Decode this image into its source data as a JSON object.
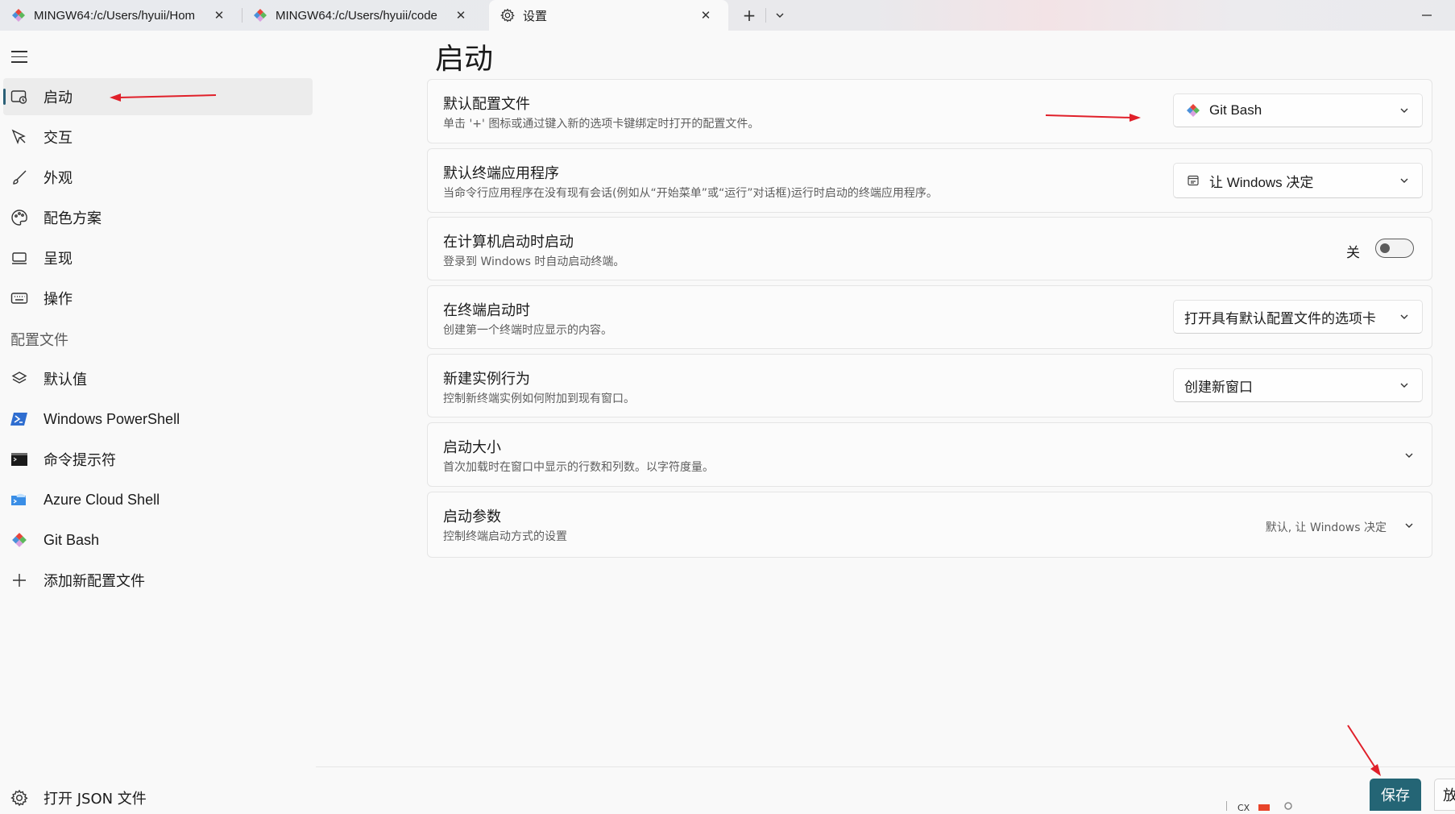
{
  "colors": {
    "accent": "#246575",
    "annotation": "#e0202a"
  },
  "tabs": [
    {
      "label": "MINGW64:/c/Users/hyuii/Hom",
      "icon": "git-bash-icon"
    },
    {
      "label": "MINGW64:/c/Users/hyuii/code",
      "icon": "git-bash-icon"
    },
    {
      "label": "设置",
      "icon": "gear-icon",
      "active": true
    }
  ],
  "sidebar": {
    "items": [
      {
        "label": "启动",
        "icon": "startup-icon",
        "active": true
      },
      {
        "label": "交互",
        "icon": "interaction-icon"
      },
      {
        "label": "外观",
        "icon": "brush-icon"
      },
      {
        "label": "配色方案",
        "icon": "palette-icon"
      },
      {
        "label": "呈现",
        "icon": "monitor-icon"
      },
      {
        "label": "操作",
        "icon": "keyboard-icon"
      }
    ],
    "profiles_heading": "配置文件",
    "profiles": [
      {
        "label": "默认值",
        "icon": "layers-icon"
      },
      {
        "label": "Windows PowerShell",
        "icon": "powershell-icon"
      },
      {
        "label": "命令提示符",
        "icon": "cmd-icon"
      },
      {
        "label": "Azure Cloud Shell",
        "icon": "azure-icon"
      },
      {
        "label": "Git Bash",
        "icon": "git-bash-icon"
      },
      {
        "label": "添加新配置文件",
        "icon": "plus-icon"
      }
    ],
    "open_json": "打开 JSON 文件"
  },
  "main": {
    "title": "启动",
    "settings": [
      {
        "title": "默认配置文件",
        "desc": "单击 '+' 图标或通过键入新的选项卡键绑定时打开的配置文件。",
        "value": "Git Bash"
      },
      {
        "title": "默认终端应用程序",
        "desc": "当命令行应用程序在没有现有会话(例如从“开始菜单”或“运行”对话框)运行时启动的终端应用程序。",
        "value": "让 Windows 决定"
      },
      {
        "title": "在计算机启动时启动",
        "desc": "登录到 Windows 时自动启动终端。",
        "toggle_label": "关",
        "toggle_on": false
      },
      {
        "title": "在终端启动时",
        "desc": "创建第一个终端时应显示的内容。",
        "value": "打开具有默认配置文件的选项卡"
      },
      {
        "title": "新建实例行为",
        "desc": "控制新终端实例如何附加到现有窗口。",
        "value": "创建新窗口"
      },
      {
        "title": "启动大小",
        "desc": "首次加载时在窗口中显示的行数和列数。以字符度量。"
      },
      {
        "title": "启动参数",
        "desc": "控制终端启动方式的设置",
        "value": "默认, 让 Windows 决定"
      }
    ]
  },
  "footer": {
    "save": "保存",
    "discard": "放"
  }
}
